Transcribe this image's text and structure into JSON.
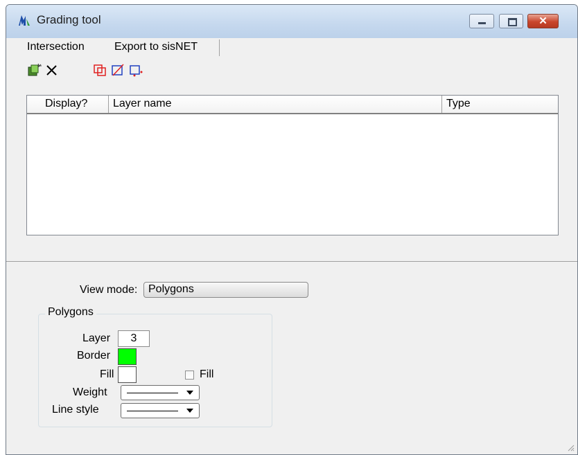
{
  "window": {
    "title": "Grading tool",
    "icon": "grading-tool-app-icon",
    "controls": {
      "minimize": "minimize",
      "maximize": "maximize",
      "close": "✕"
    }
  },
  "menu": {
    "items": [
      "Intersection",
      "Export to sisNET"
    ]
  },
  "toolbar": {
    "icons": [
      "add-layer-icon",
      "delete-icon",
      "polygon-select-icon",
      "polygon-delete-icon",
      "polygon-point-icon"
    ]
  },
  "layer_list": {
    "columns": [
      "Display?",
      "Layer name",
      "Type"
    ],
    "rows": []
  },
  "view_mode": {
    "label": "View mode:",
    "value": "Polygons"
  },
  "polygons": {
    "group_label": "Polygons",
    "layer_label": "Layer",
    "layer_value": "3",
    "border_label": "Border",
    "border_color": "#00ff00",
    "fill_label": "Fill",
    "fill_color": "#ffffff",
    "fill_checkbox_label": "Fill",
    "fill_checked": false,
    "weight_label": "Weight",
    "line_style_label": "Line style"
  },
  "colors": {
    "accent_red": "#e02020",
    "window_bg": "#f0f0f0"
  }
}
